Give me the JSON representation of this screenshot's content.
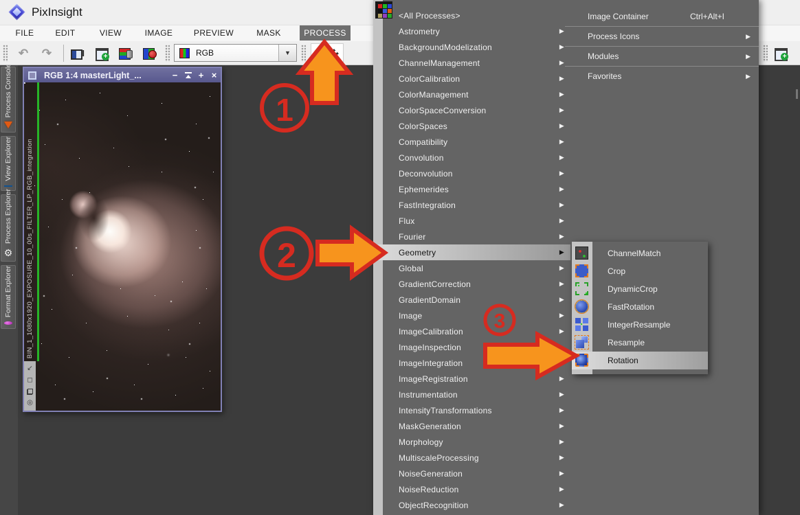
{
  "app": {
    "title": "PixInsight"
  },
  "menubar": {
    "items": [
      {
        "label": "FILE"
      },
      {
        "label": "EDIT"
      },
      {
        "label": "VIEW"
      },
      {
        "label": "IMAGE"
      },
      {
        "label": "PREVIEW"
      },
      {
        "label": "MASK"
      },
      {
        "label": "PROCESS",
        "state": "active"
      }
    ]
  },
  "toolbar": {
    "view_selector_value": "RGB",
    "dropdown_arrow": "▼"
  },
  "sidebar": {
    "tabs": [
      {
        "label": "Process Console",
        "icon": "process-console-icon"
      },
      {
        "label": "View Explorer",
        "icon": "view-explorer-icon"
      },
      {
        "label": "Process Explorer",
        "icon": "process-explorer-icon",
        "glyph": "⚙"
      },
      {
        "label": "Format Explorer",
        "icon": "format-explorer-icon"
      }
    ]
  },
  "image_window": {
    "title": "RGB 1:4 masterLight_...",
    "buttons": {
      "minimize": "−",
      "zoom": "+",
      "close": "×"
    },
    "view_id_label": "BIN_1_1080x1920_EXPOSURE_10_00s_FILTER_LP_RGB_integration",
    "mode_glyphs": {
      "pan": "↙",
      "frame": "◻",
      "target": "◎"
    }
  },
  "process_menu": {
    "column1": [
      {
        "label": "<All Processes>",
        "arrow": ""
      },
      {
        "label": "Astrometry",
        "arrow": "▶"
      },
      {
        "label": "BackgroundModelization",
        "arrow": "▶"
      },
      {
        "label": "ChannelManagement",
        "arrow": "▶"
      },
      {
        "label": "ColorCalibration",
        "arrow": "▶"
      },
      {
        "label": "ColorManagement",
        "arrow": "▶"
      },
      {
        "label": "ColorSpaceConversion",
        "arrow": "▶"
      },
      {
        "label": "ColorSpaces",
        "arrow": "▶"
      },
      {
        "label": "Compatibility",
        "arrow": "▶"
      },
      {
        "label": "Convolution",
        "arrow": "▶"
      },
      {
        "label": "Deconvolution",
        "arrow": "▶"
      },
      {
        "label": "Ephemerides",
        "arrow": "▶"
      },
      {
        "label": "FastIntegration",
        "arrow": "▶"
      },
      {
        "label": "Flux",
        "arrow": "▶"
      },
      {
        "label": "Fourier",
        "arrow": "▶"
      },
      {
        "label": "Geometry",
        "arrow": "▶",
        "state": "highlighted"
      },
      {
        "label": "Global",
        "arrow": "▶"
      },
      {
        "label": "GradientCorrection",
        "arrow": "▶"
      },
      {
        "label": "GradientDomain",
        "arrow": "▶"
      },
      {
        "label": "Image",
        "arrow": "▶"
      },
      {
        "label": "ImageCalibration",
        "arrow": "▶"
      },
      {
        "label": "ImageInspection",
        "arrow": "▶"
      },
      {
        "label": "ImageIntegration",
        "arrow": "▶"
      },
      {
        "label": "ImageRegistration",
        "arrow": "▶"
      },
      {
        "label": "Instrumentation",
        "arrow": "▶"
      },
      {
        "label": "IntensityTransformations",
        "arrow": "▶"
      },
      {
        "label": "MaskGeneration",
        "arrow": "▶"
      },
      {
        "label": "Morphology",
        "arrow": "▶"
      },
      {
        "label": "MultiscaleProcessing",
        "arrow": "▶"
      },
      {
        "label": "NoiseGeneration",
        "arrow": "▶"
      },
      {
        "label": "NoiseReduction",
        "arrow": "▶"
      },
      {
        "label": "ObjectRecognition",
        "arrow": "▶"
      }
    ],
    "column2": [
      {
        "label": "Image Container",
        "shortcut": "Ctrl+Alt+I",
        "arrow": "",
        "has_icon": true
      },
      {
        "label": "Process Icons",
        "shortcut": "",
        "arrow": "▶"
      },
      {
        "label": "Modules",
        "shortcut": "",
        "arrow": "▶"
      },
      {
        "label": "Favorites",
        "shortcut": "",
        "arrow": "▶"
      }
    ]
  },
  "geometry_submenu": {
    "items": [
      {
        "label": "ChannelMatch",
        "icon": "channelmatch-icon"
      },
      {
        "label": "Crop",
        "icon": "crop-icon"
      },
      {
        "label": "DynamicCrop",
        "icon": "dynamiccrop-icon"
      },
      {
        "label": "FastRotation",
        "icon": "fastrotation-icon"
      },
      {
        "label": "IntegerResample",
        "icon": "integerresample-icon"
      },
      {
        "label": "Resample",
        "icon": "resample-icon"
      },
      {
        "label": "Rotation",
        "icon": "rotation-icon",
        "state": "highlighted"
      }
    ]
  },
  "annotations": {
    "steps": [
      "1",
      "2",
      "3"
    ]
  },
  "colors": {
    "annotation_red": "#d62b20",
    "annotation_orange": "#f7941d",
    "selection_green": "#27b427",
    "window_titlebar": "#63639a",
    "menu_bg": "#646464",
    "workspace_bg": "#3c3c3c",
    "process_active_bg": "#6e6e6e"
  }
}
